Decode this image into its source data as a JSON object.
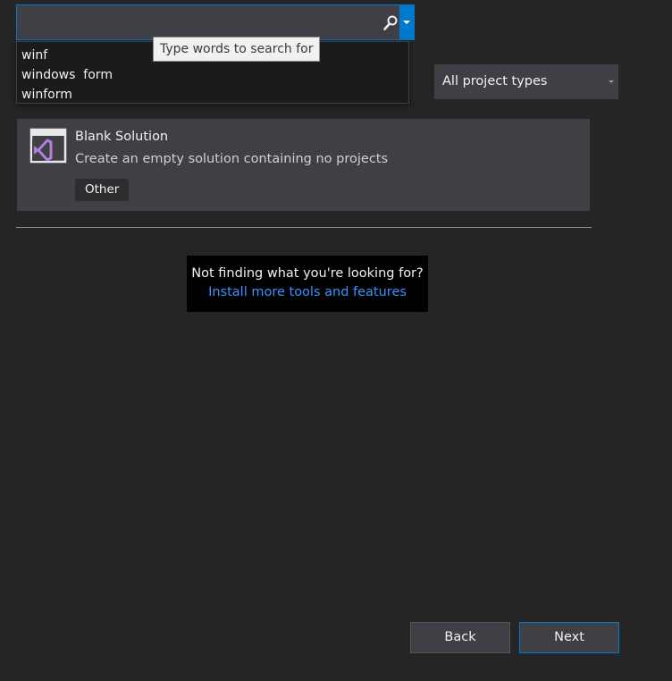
{
  "search": {
    "value": "",
    "suggestions": [
      "winf",
      "windows  form",
      "winform"
    ],
    "tooltip": "Type words to search for"
  },
  "filter": {
    "project_type": "All project types"
  },
  "template": {
    "title": "Blank Solution",
    "description": "Create an empty solution containing no projects",
    "tag": "Other",
    "icon": "visual-studio-solution-icon"
  },
  "help": {
    "text": "Not finding what you're looking for?",
    "link": "Install more tools and features"
  },
  "buttons": {
    "back": "Back",
    "next": "Next"
  },
  "colors": {
    "accent": "#007acc",
    "background": "#252526",
    "card": "#3f3f46",
    "link": "#3794ff",
    "vs_purple": "#b180d7"
  }
}
